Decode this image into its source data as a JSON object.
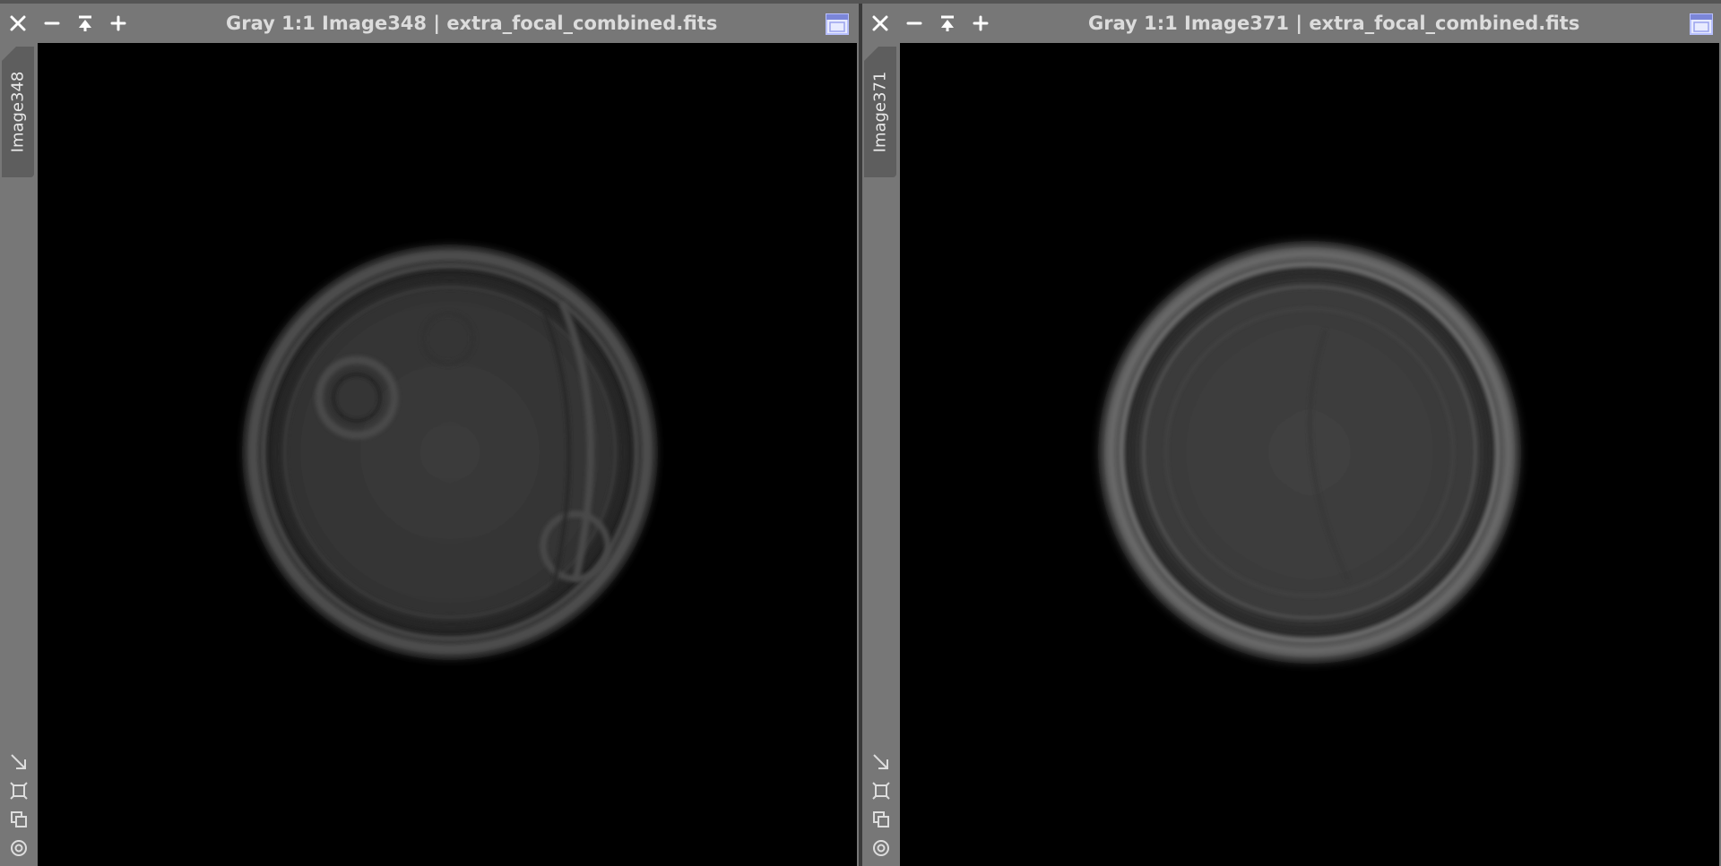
{
  "windows": [
    {
      "title": "Gray 1:1 Image348 | extra_focal_combined.fits",
      "tab_label": "Image348"
    },
    {
      "title": "Gray 1:1 Image371 | extra_focal_combined.fits",
      "tab_label": "Image371"
    }
  ],
  "icons": {
    "close": "close-icon",
    "minimize": "minimize-icon",
    "shade": "shade-icon",
    "maximize": "plus-icon",
    "restore": "restore-window-icon",
    "zoom_fit": "zoom-to-fit-icon",
    "fit_window": "fit-window-icon",
    "clone": "clone-icon",
    "center": "center-target-icon"
  },
  "colors": {
    "frame": "#777777",
    "tab": "#5e5e5e",
    "title_text": "#dcdcdc",
    "restore_accent": "#b8c0ff"
  }
}
